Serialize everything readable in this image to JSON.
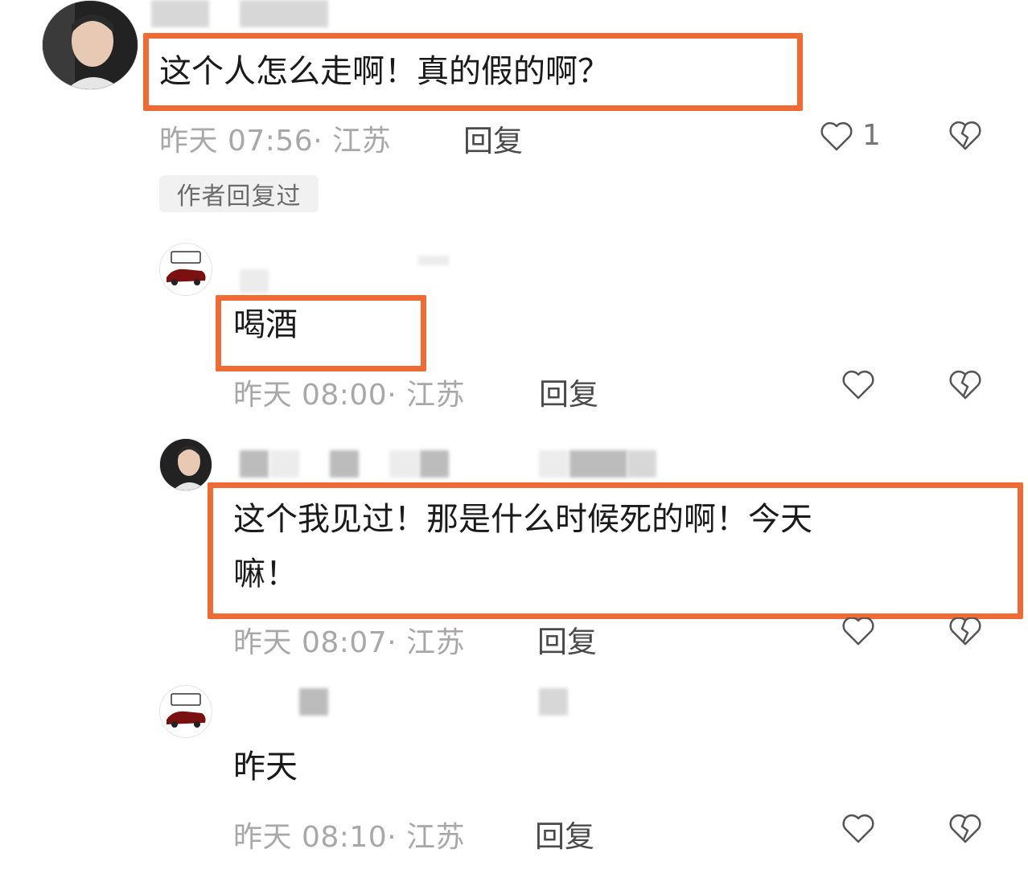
{
  "comments": [
    {
      "text": "这个人怎么走啊！真的假的啊？",
      "meta": "昨天 07:56· 江苏",
      "reply_label": "回复",
      "like_count": "1",
      "author_tag": "作者回复过"
    },
    {
      "text": "喝酒",
      "meta": "昨天 08:00· 江苏",
      "reply_label": "回复"
    },
    {
      "text_line1": "这个我见过！那是什么时候死的啊！今天",
      "text_line2": "嘛！",
      "meta": "昨天 08:07· 江苏",
      "reply_label": "回复"
    },
    {
      "text": "昨天",
      "meta": "昨天 08:10· 江苏",
      "reply_label": "回复"
    }
  ],
  "colors": {
    "highlight": "#f06a33",
    "meta_text": "#a8a8a8",
    "reply_text": "#4a4a4a"
  },
  "icons": {
    "like": "heart-outline-icon",
    "dislike": "broken-heart-icon",
    "avatar_person": "person-avatar",
    "avatar_car": "car-avatar"
  }
}
